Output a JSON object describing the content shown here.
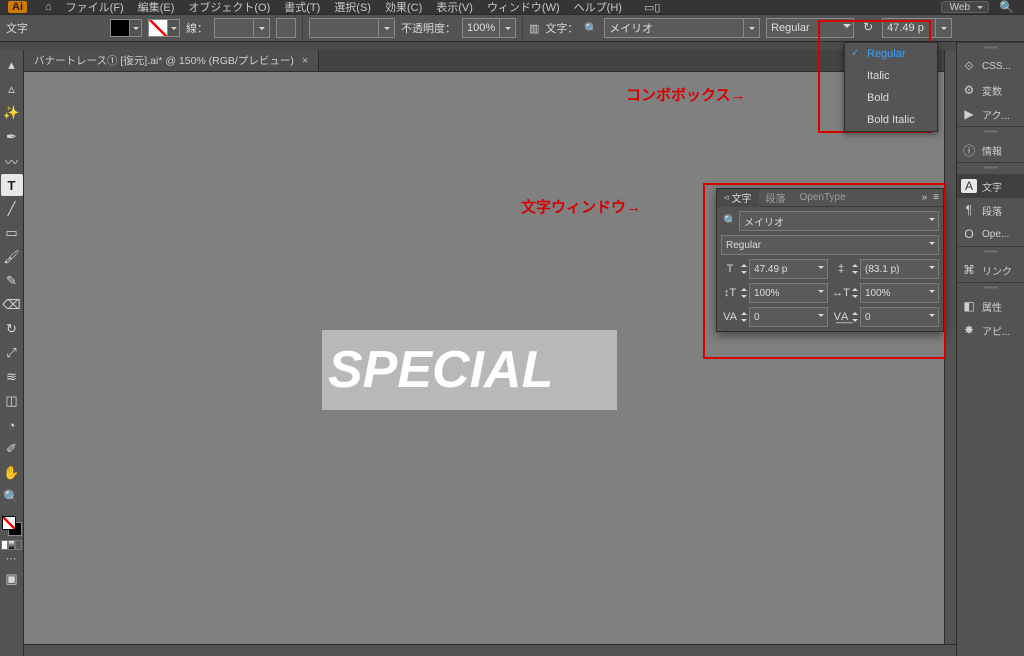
{
  "menu": {
    "items": [
      "ファイル(F)",
      "編集(E)",
      "オブジェクト(O)",
      "書式(T)",
      "選択(S)",
      "効果(C)",
      "表示(V)",
      "ウィンドウ(W)",
      "ヘルプ(H)"
    ]
  },
  "workspace": "Web",
  "control": {
    "tool_label": "文字",
    "stroke_label": "線：",
    "stroke_weight": "",
    "opacity_label": "不透明度：",
    "opacity_value": "100%",
    "char_label": "文字：",
    "font_family": "メイリオ",
    "font_style": "Regular",
    "font_size": "47.49 p"
  },
  "style_options": [
    "Regular",
    "Italic",
    "Bold",
    "Bold Italic"
  ],
  "style_selected": "Regular",
  "annotations": {
    "combo": "コンボボックス→",
    "charwin": "文字ウィンドウ→"
  },
  "tab": {
    "title": "バナートレース① [復元].ai* @ 150% (RGB/プレビュー)"
  },
  "artboard": {
    "text": "SPECIAL"
  },
  "dock_items": [
    {
      "icon": "⟐",
      "label": "CSS..."
    },
    {
      "icon": "⚙",
      "label": "変数"
    },
    {
      "icon": "▶",
      "label": "アク..."
    },
    {
      "icon": "ⓘ",
      "label": "情報"
    },
    {
      "icon": "A",
      "label": "文字",
      "active": true
    },
    {
      "icon": "¶",
      "label": "段落"
    },
    {
      "icon": "O",
      "label": "Ope..."
    },
    {
      "icon": "⌘",
      "label": "リンク"
    },
    {
      "icon": "◧",
      "label": "属性"
    },
    {
      "icon": "✸",
      "label": "アピ..."
    }
  ],
  "char_panel": {
    "tabs": [
      "文字",
      "段落",
      "OpenType"
    ],
    "font": "メイリオ",
    "style": "Regular",
    "size": "47.49 p",
    "leading": "(83.1 p)",
    "hscale": "100%",
    "vscale": "100%",
    "kerning": "0",
    "tracking": "0"
  }
}
